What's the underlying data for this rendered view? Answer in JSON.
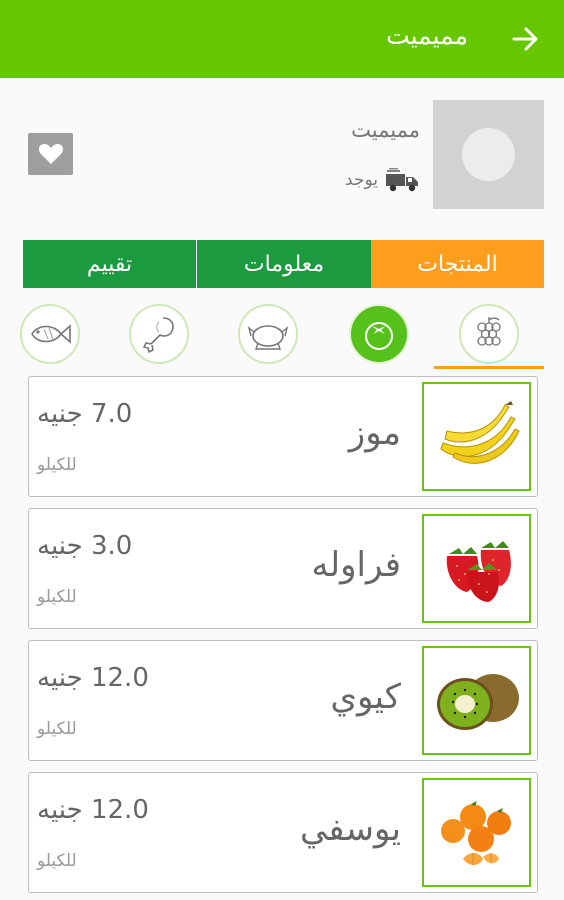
{
  "header": {
    "title": "مميميت",
    "back_icon": "arrow-back-icon"
  },
  "store": {
    "name": "مميميت",
    "delivery_label": "يوجد",
    "delivery_icon": "truck-icon",
    "favorite_icon": "heart-icon"
  },
  "tabs": [
    {
      "label": "تقييم"
    },
    {
      "label": "معلومات"
    },
    {
      "label": "المنتجات",
      "selected": true
    }
  ],
  "categories": [
    {
      "icon": "fish-icon"
    },
    {
      "icon": "chicken-leg-icon"
    },
    {
      "icon": "poultry-icon"
    },
    {
      "icon": "tomato-icon",
      "selected": true
    },
    {
      "icon": "grapes-icon"
    }
  ],
  "products": [
    {
      "name": "موز",
      "price": "7.0 جنيه",
      "unit": "للكيلو",
      "image": "banana"
    },
    {
      "name": "فراوله",
      "price": "3.0 جنيه",
      "unit": "للكيلو",
      "image": "strawberry"
    },
    {
      "name": "كيوي",
      "price": "12.0 جنيه",
      "unit": "للكيلو",
      "image": "kiwi"
    },
    {
      "name": "يوسفي",
      "price": "12.0 جنيه",
      "unit": "للكيلو",
      "image": "mandarin"
    }
  ],
  "colors": {
    "appbar": "#66c600",
    "tab_selected": "#ff9d1c",
    "tab_default": "#1b9a3f",
    "category_active": "#55c11a",
    "thumb_border": "#6ac414"
  }
}
